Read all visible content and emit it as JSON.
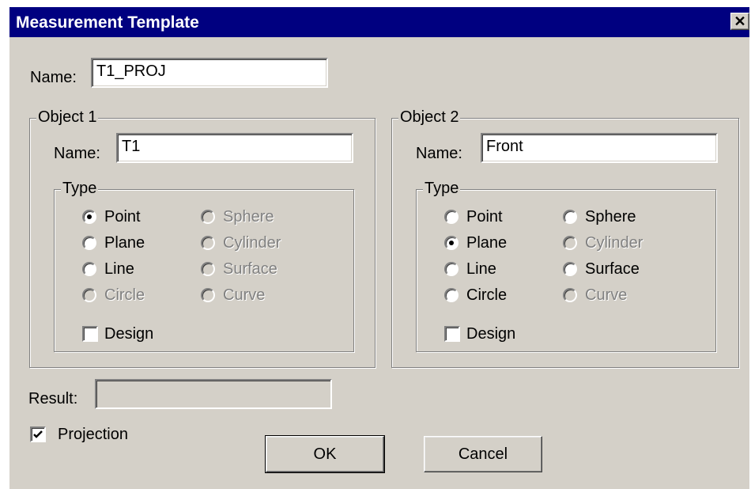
{
  "dialog": {
    "title": "Measurement Template",
    "close_label": "✕",
    "name_label": "Name:",
    "name_value": "T1_PROJ",
    "result_label": "Result:",
    "result_value": "",
    "projection_label": "Projection",
    "projection_checked": true,
    "ok_label": "OK",
    "cancel_label": "Cancel"
  },
  "object1": {
    "title": "Object 1",
    "name_label": "Name:",
    "name_value": "T1",
    "type_label": "Type",
    "options": [
      {
        "label": "Point",
        "checked": true,
        "enabled": true
      },
      {
        "label": "Plane",
        "checked": false,
        "enabled": true
      },
      {
        "label": "Line",
        "checked": false,
        "enabled": true
      },
      {
        "label": "Circle",
        "checked": false,
        "enabled": false
      },
      {
        "label": "Sphere",
        "checked": false,
        "enabled": false
      },
      {
        "label": "Cylinder",
        "checked": false,
        "enabled": false
      },
      {
        "label": "Surface",
        "checked": false,
        "enabled": false
      },
      {
        "label": "Curve",
        "checked": false,
        "enabled": false
      }
    ],
    "design_label": "Design",
    "design_checked": false
  },
  "object2": {
    "title": "Object 2",
    "name_label": "Name:",
    "name_value": "Front",
    "type_label": "Type",
    "options": [
      {
        "label": "Point",
        "checked": false,
        "enabled": true
      },
      {
        "label": "Plane",
        "checked": true,
        "enabled": true
      },
      {
        "label": "Line",
        "checked": false,
        "enabled": true
      },
      {
        "label": "Circle",
        "checked": false,
        "enabled": true
      },
      {
        "label": "Sphere",
        "checked": false,
        "enabled": true
      },
      {
        "label": "Cylinder",
        "checked": false,
        "enabled": false
      },
      {
        "label": "Surface",
        "checked": false,
        "enabled": true
      },
      {
        "label": "Curve",
        "checked": false,
        "enabled": false
      }
    ],
    "design_label": "Design",
    "design_checked": false
  }
}
